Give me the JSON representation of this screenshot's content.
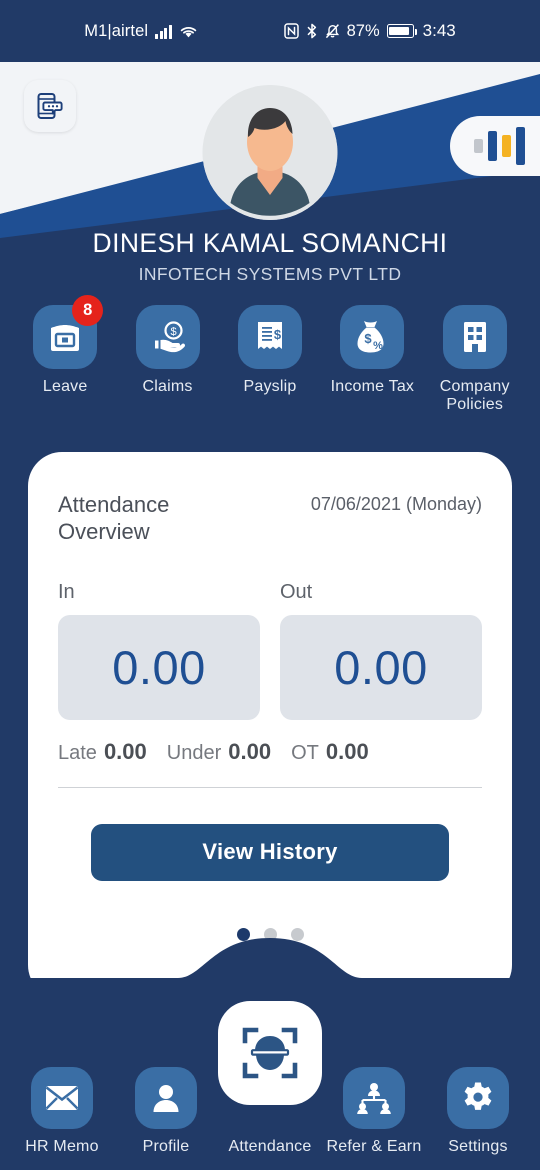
{
  "statusbar": {
    "carrier": "M1|airtel",
    "battery_percent": "87%",
    "clock": "3:43",
    "icons": [
      "signal-bars-icon",
      "wifi-icon",
      "nfc-icon",
      "bluetooth-icon",
      "mute-icon",
      "battery-icon"
    ]
  },
  "header": {
    "chat_icon": "chat-phone-icon",
    "chart_icon": "bar-chart-icon",
    "avatar": "user-avatar",
    "colors": {
      "navy": "#213a67",
      "mid_blue": "#1f4f93",
      "light_panel": "#f2f4f7",
      "tile_blue": "#3a6ea5",
      "accent_yellow": "#f4b223",
      "badge_red": "#e5231b"
    }
  },
  "profile": {
    "name": "DINESH KAMAL SOMANCHI",
    "organization": "INFOTECH SYSTEMS PVT LTD"
  },
  "quick_actions": [
    {
      "label": "Leave",
      "icon": "calendar-icon",
      "badge": "8"
    },
    {
      "label": "Claims",
      "icon": "hand-coin-icon",
      "badge": ""
    },
    {
      "label": "Payslip",
      "icon": "receipt-dollar-icon",
      "badge": ""
    },
    {
      "label": "Income Tax",
      "icon": "money-bag-percent-icon",
      "badge": ""
    },
    {
      "label": "Company Policies",
      "icon": "building-icon",
      "badge": ""
    }
  ],
  "attendance_card": {
    "title": "Attendance Overview",
    "date": "07/06/2021 (Monday)",
    "in_label": "In",
    "in_value": "0.00",
    "out_label": "Out",
    "out_value": "0.00",
    "metrics": [
      {
        "label": "Late",
        "value": "0.00"
      },
      {
        "label": "Under",
        "value": "0.00"
      },
      {
        "label": "OT",
        "value": "0.00"
      }
    ],
    "history_button": "View History",
    "page_dots": {
      "count": 3,
      "active_index": 0
    }
  },
  "bottom_nav": [
    {
      "label": "HR Memo",
      "icon": "envelope-icon",
      "active": false
    },
    {
      "label": "Profile",
      "icon": "person-icon",
      "active": false
    },
    {
      "label": "Attendance",
      "icon": "face-scan-icon",
      "active": true
    },
    {
      "label": "Refer & Earn",
      "icon": "org-people-icon",
      "active": false
    },
    {
      "label": "Settings",
      "icon": "gear-icon",
      "active": false
    }
  ]
}
